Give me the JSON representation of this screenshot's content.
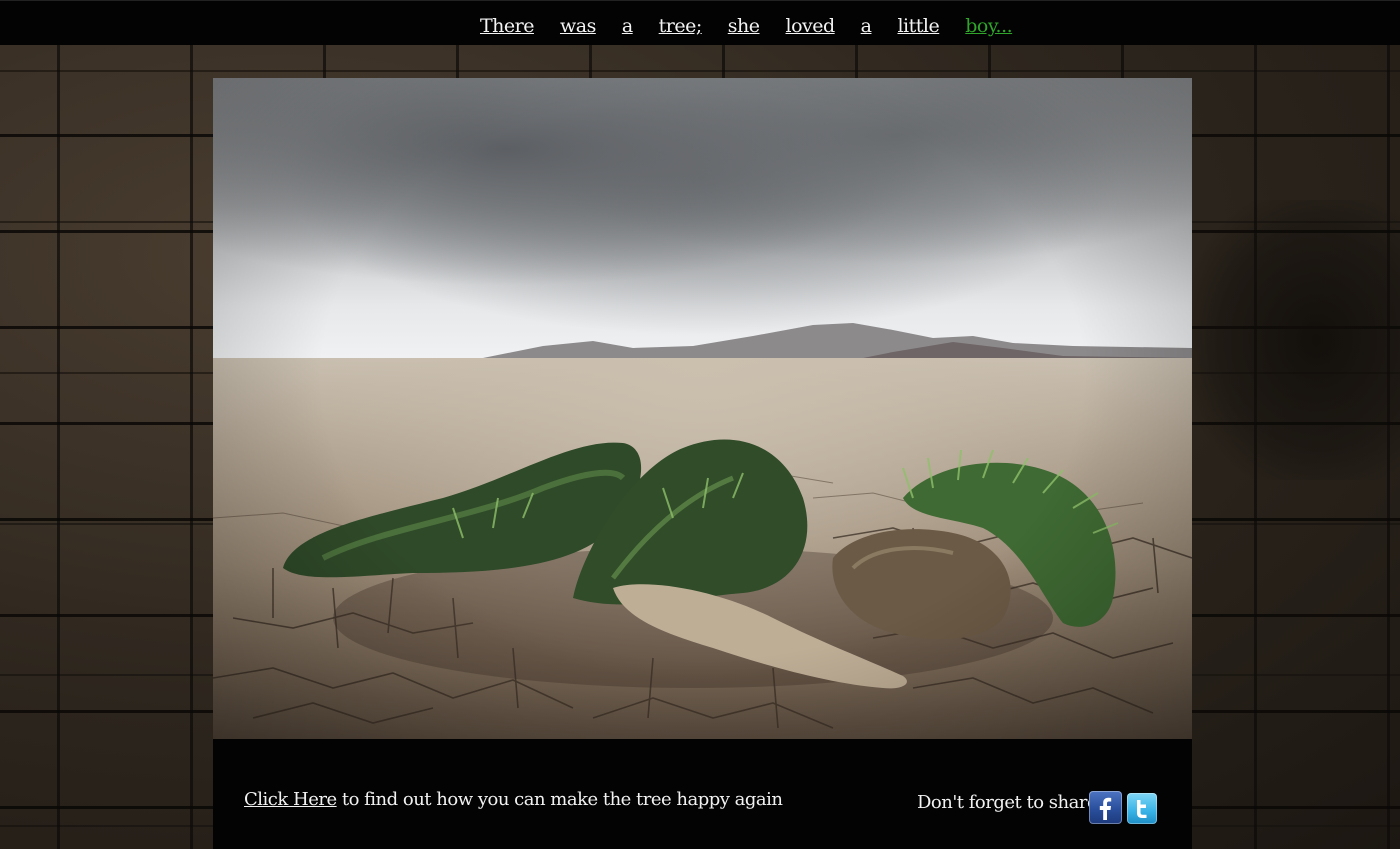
{
  "page": {
    "background_color": "#2e271f"
  },
  "header": {
    "title_words": [
      "There",
      "was",
      "a",
      "tree;",
      "she",
      "loved",
      "a",
      "little",
      "boy..."
    ],
    "accent_color": "#2fa52a"
  },
  "hero": {
    "image": "sculpture-in-desert-photo"
  },
  "footer": {
    "cta_link_label": "Click Here",
    "cta_text": " to find out how you can make the tree happy again",
    "share_label": "Don't forget to share!",
    "facebook_icon": "facebook-icon",
    "twitter_icon": "twitter-icon"
  }
}
